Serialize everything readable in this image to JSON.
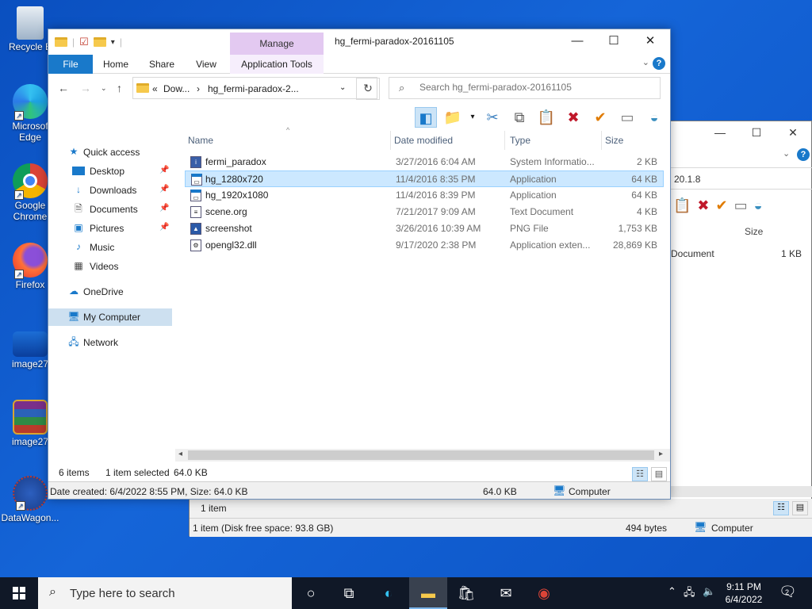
{
  "desktop": {
    "icons": [
      {
        "label": "Recycle B"
      },
      {
        "label": "Microsof Edge"
      },
      {
        "label": "Google Chrome"
      },
      {
        "label": "Firefox"
      },
      {
        "label": "image27"
      },
      {
        "label": "image27"
      },
      {
        "label": "DataWagon..."
      }
    ]
  },
  "bg_window": {
    "address_fragment": "20.1.8",
    "col_size": "Size",
    "row_type": "Document",
    "row_size": "1 KB",
    "status_items": "1 item",
    "status_disk": "1 item (Disk free space: 93.8 GB)",
    "status_bytes": "494 bytes",
    "status_location": "Computer"
  },
  "window": {
    "title": "hg_fermi-paradox-20161105",
    "manage_label": "Manage",
    "tabs": {
      "file": "File",
      "home": "Home",
      "share": "Share",
      "view": "View",
      "app_tools": "Application Tools"
    },
    "help": "?",
    "address": {
      "overflow": "«",
      "crumb1": "Dow...",
      "crumb2": "hg_fermi-paradox-2..."
    },
    "search_placeholder": "Search hg_fermi-paradox-20161105"
  },
  "nav": {
    "quick_access": "Quick access",
    "desktop": "Desktop",
    "downloads": "Downloads",
    "documents": "Documents",
    "pictures": "Pictures",
    "music": "Music",
    "videos": "Videos",
    "onedrive": "OneDrive",
    "my_computer": "My Computer",
    "network": "Network"
  },
  "columns": {
    "name": "Name",
    "date": "Date modified",
    "type": "Type",
    "size": "Size"
  },
  "files": [
    {
      "name": "fermi_paradox",
      "date": "3/27/2016 6:04 AM",
      "type": "System Informatio...",
      "size": "2 KB",
      "icon": "system-info-icon"
    },
    {
      "name": "hg_1280x720",
      "date": "11/4/2016 8:35 PM",
      "type": "Application",
      "size": "64 KB",
      "icon": "application-icon"
    },
    {
      "name": "hg_1920x1080",
      "date": "11/4/2016 8:39 PM",
      "type": "Application",
      "size": "64 KB",
      "icon": "application-icon"
    },
    {
      "name": "scene.org",
      "date": "7/21/2017 9:09 AM",
      "type": "Text Document",
      "size": "4 KB",
      "icon": "text-document-icon"
    },
    {
      "name": "screenshot",
      "date": "3/26/2016 10:39 AM",
      "type": "PNG File",
      "size": "1,753 KB",
      "icon": "image-file-icon"
    },
    {
      "name": "opengl32.dll",
      "date": "9/17/2020 2:38 PM",
      "type": "Application exten...",
      "size": "28,869 KB",
      "icon": "dll-file-icon"
    }
  ],
  "status": {
    "count": "6 items",
    "selected": "1 item selected",
    "selected_size": "64.0 KB"
  },
  "details": {
    "created": "Date created: 6/4/2022 8:55 PM, Size: 64.0 KB",
    "size": "64.0 KB",
    "location": "Computer"
  },
  "taskbar": {
    "search_placeholder": "Type here to search",
    "time": "9:11 PM",
    "date": "6/4/2022",
    "notifications": "2"
  },
  "colors": {
    "accent": "#1979ca",
    "selection": "#cce8ff",
    "manage": "#e3c9f1",
    "taskbar": "#101827"
  }
}
